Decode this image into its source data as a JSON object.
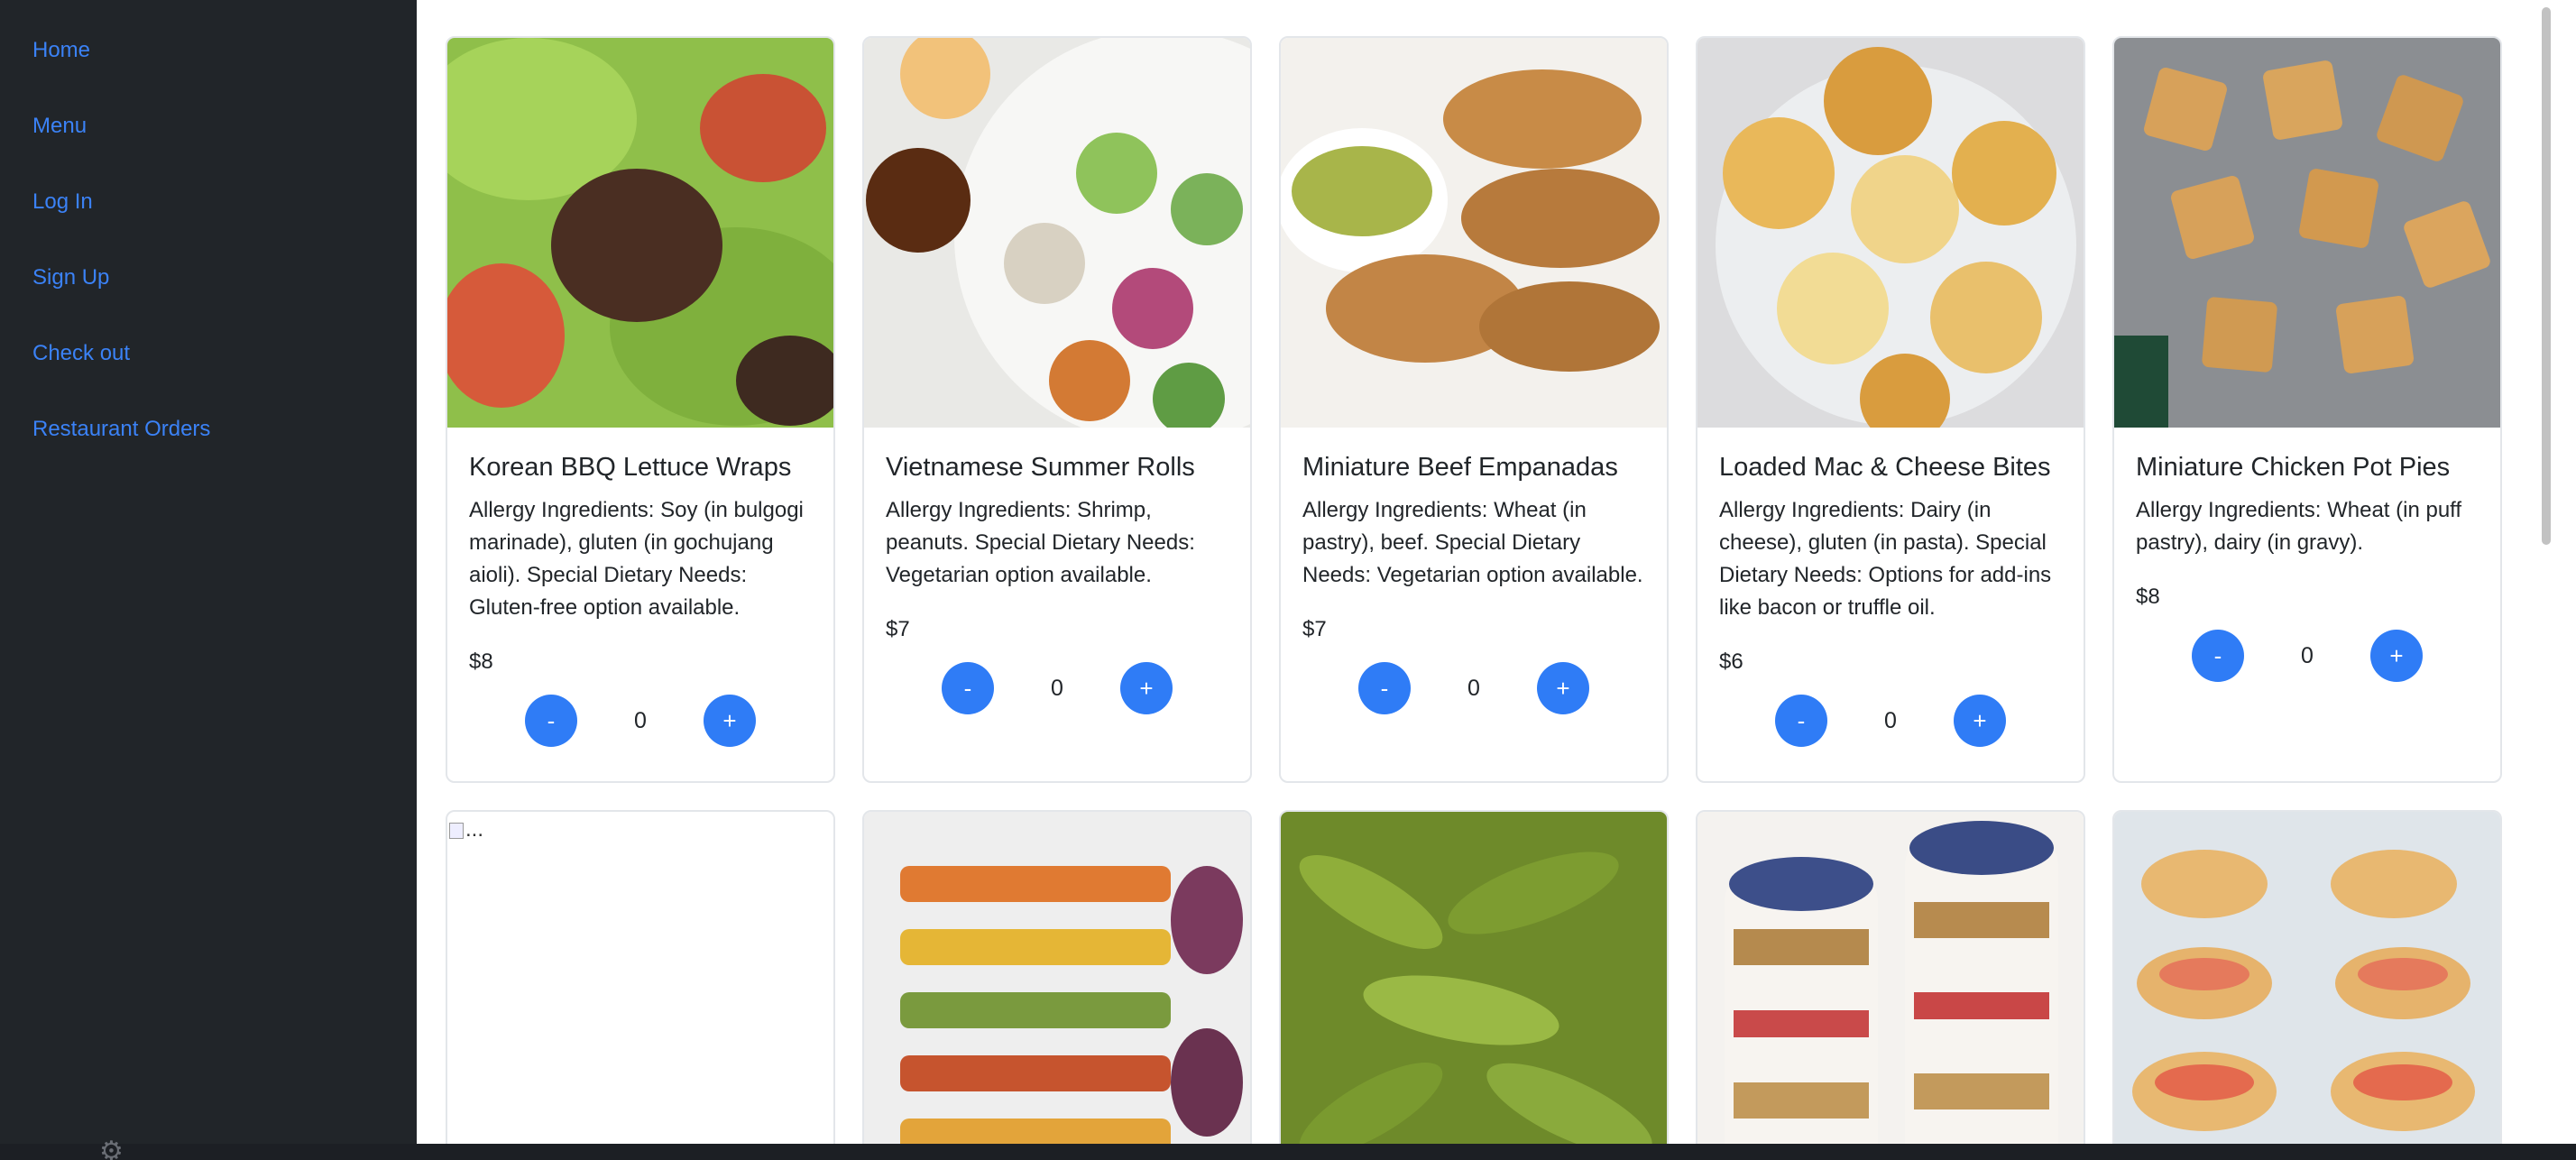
{
  "nav": {
    "items": [
      {
        "label": "Home"
      },
      {
        "label": "Menu"
      },
      {
        "label": "Log In"
      },
      {
        "label": "Sign Up"
      },
      {
        "label": "Check out"
      },
      {
        "label": "Restaurant Orders"
      }
    ]
  },
  "colors": {
    "sidebar": "#212529",
    "link": "#3b82f6",
    "button": "#2f7cf6"
  },
  "cards_row1": [
    {
      "title": "Korean BBQ Lettuce Wraps",
      "desc": "Allergy Ingredients: Soy (in bulgogi marinade), gluten (in gochujang aioli). Special Dietary Needs: Gluten-free option available.",
      "price": "$8",
      "qty": "0",
      "minus": "-",
      "plus": "+"
    },
    {
      "title": "Vietnamese Summer Rolls",
      "desc": "Allergy Ingredients: Shrimp, peanuts. Special Dietary Needs: Vegetarian option available.",
      "price": "$7",
      "qty": "0",
      "minus": "-",
      "plus": "+"
    },
    {
      "title": "Miniature Beef Empanadas",
      "desc": "Allergy Ingredients: Wheat (in pastry), beef. Special Dietary Needs: Vegetarian option available.",
      "price": "$7",
      "qty": "0",
      "minus": "-",
      "plus": "+"
    },
    {
      "title": "Loaded Mac & Cheese Bites",
      "desc": "Allergy Ingredients: Dairy (in cheese), gluten (in pasta). Special Dietary Needs: Options for add-ins like bacon or truffle oil.",
      "price": "$6",
      "qty": "0",
      "minus": "-",
      "plus": "+"
    },
    {
      "title": "Miniature Chicken Pot Pies",
      "desc": "Allergy Ingredients: Wheat (in puff pastry), dairy (in gravy).",
      "price": "$8",
      "qty": "0",
      "minus": "-",
      "plus": "+"
    }
  ],
  "broken_image_alt": "...",
  "icons": {
    "taskbar": "gear-icon"
  }
}
